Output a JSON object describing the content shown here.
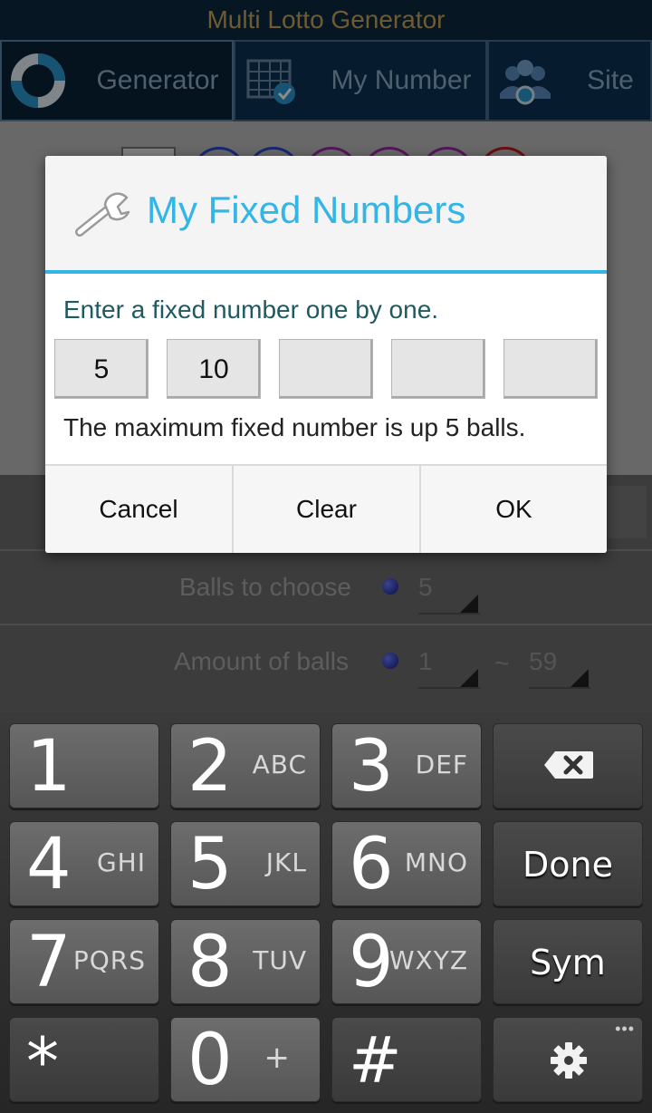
{
  "app": {
    "title": "Multi Lotto Generator",
    "tabs": [
      {
        "label": "Generator",
        "icon": "lifebuoy-icon"
      },
      {
        "label": "My Number",
        "icon": "calendar-check-icon"
      },
      {
        "label": "Site",
        "icon": "people-gear-icon"
      }
    ],
    "rows": {
      "balls_to_choose": {
        "label": "Balls to choose",
        "value": "5"
      },
      "amount_of_balls": {
        "label": "Amount of balls",
        "from": "1",
        "separator": "~",
        "to": "59"
      }
    }
  },
  "dialog": {
    "title": "My Fixed Numbers",
    "icon": "wrench-icon",
    "message": "Enter a fixed number one by one.",
    "fixed_numbers": [
      "5",
      "10",
      "",
      "",
      ""
    ],
    "note": "The maximum fixed number is up 5 balls.",
    "buttons": {
      "cancel": "Cancel",
      "clear": "Clear",
      "ok": "OK"
    },
    "accent_color": "#33b5e5"
  },
  "keyboard": {
    "keys": [
      {
        "digit": "1",
        "letters": ""
      },
      {
        "digit": "2",
        "letters": "ABC"
      },
      {
        "digit": "3",
        "letters": "DEF"
      },
      {
        "digit": "4",
        "letters": "GHI"
      },
      {
        "digit": "5",
        "letters": "JKL"
      },
      {
        "digit": "6",
        "letters": "MNO"
      },
      {
        "digit": "7",
        "letters": "PQRS"
      },
      {
        "digit": "8",
        "letters": "TUV"
      },
      {
        "digit": "9",
        "letters": "WXYZ"
      },
      {
        "digit": "*",
        "letters": ""
      },
      {
        "digit": "0",
        "letters": "+"
      },
      {
        "digit": "#",
        "letters": ""
      }
    ],
    "done_label": "Done",
    "sym_label": "Sym",
    "more_dots": "•••"
  }
}
